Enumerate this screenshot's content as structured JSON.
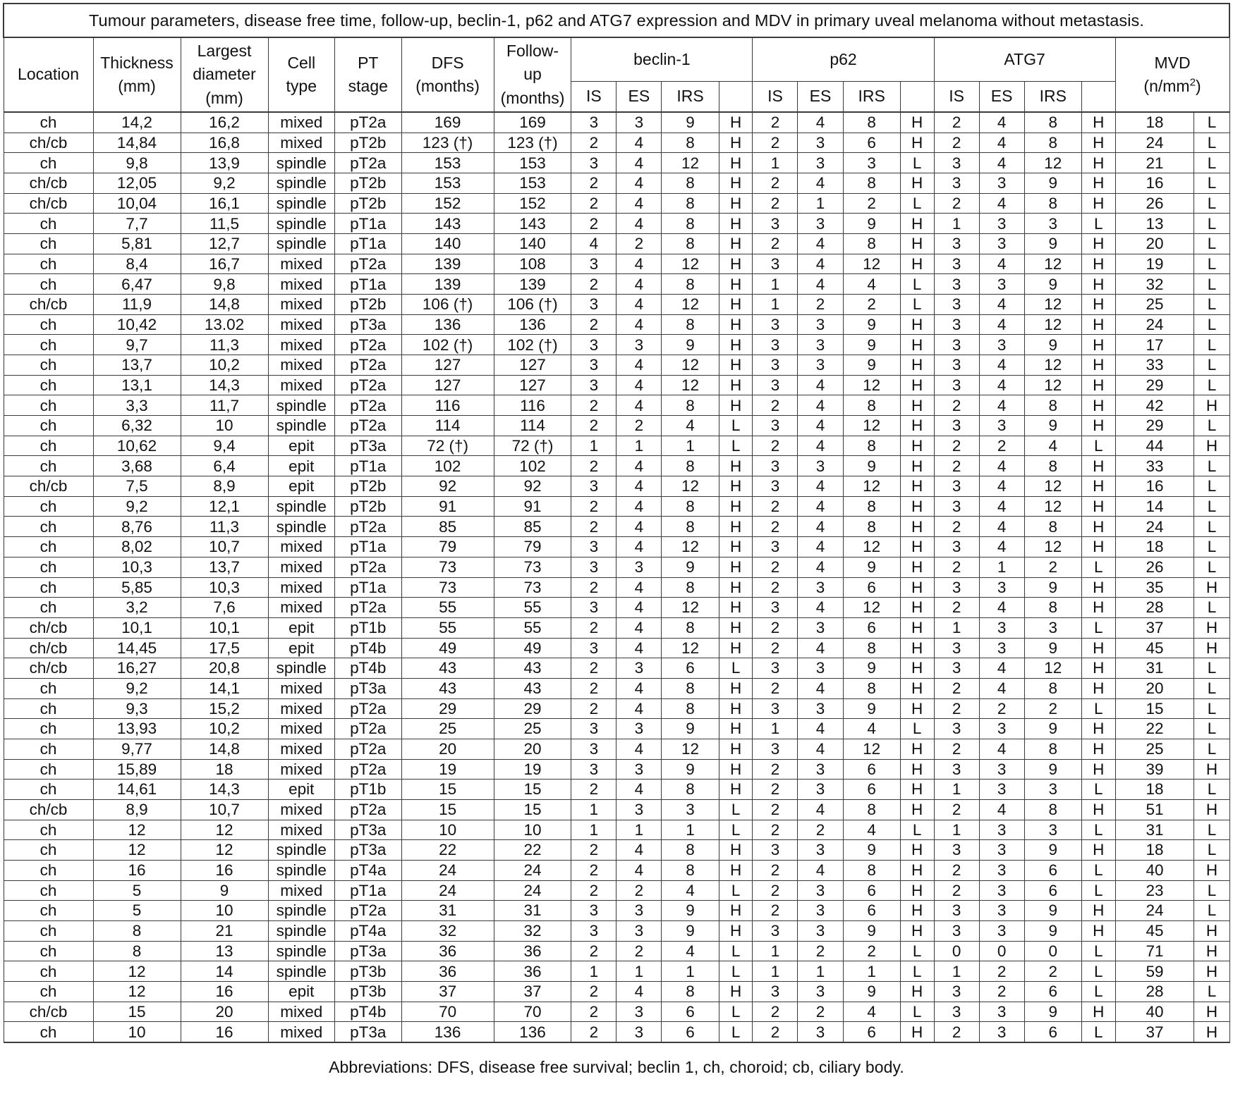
{
  "title": "Tumour parameters, disease free time, follow-up, beclin-1, p62 and ATG7 expression and MDV in primary uveal melanoma without metastasis.",
  "footer": "Abbreviations: DFS, disease free survival; beclin 1,  ch, choroid; cb, ciliary body.",
  "header": {
    "location": "Location",
    "thickness_l1": "Thickness",
    "thickness_l2": "(mm)",
    "diameter_l1": "Largest",
    "diameter_l2": "diameter",
    "diameter_l3": "(mm)",
    "celltype_l1": "Cell",
    "celltype_l2": "type",
    "ptstage_l1": "PT",
    "ptstage_l2": "stage",
    "dfs_l1": "DFS",
    "dfs_l2": "(months)",
    "followup_l1": "Follow-",
    "followup_l2": "up",
    "followup_l3": "(months)",
    "beclin1": "beclin-1",
    "p62": "p62",
    "atg7": "ATG7",
    "mvd_l1": "MVD",
    "mvd_l2_pre": "(n/mm",
    "mvd_l2_sup": "2",
    "mvd_l2_post": ")",
    "is": "IS",
    "es": "ES",
    "irs": "IRS",
    "blank": ""
  },
  "chart_data": {
    "type": "table",
    "title": "Tumour parameters, disease free time, follow-up, beclin-1, p62 and ATG7 expression and MDV in primary uveal melanoma without metastasis.",
    "columns": [
      "Location",
      "Thickness (mm)",
      "Largest diameter (mm)",
      "Cell type",
      "PT stage",
      "DFS (months)",
      "Follow-up (months)",
      "beclin-1 IS",
      "beclin-1 ES",
      "beclin-1 IRS",
      "beclin-1 HL",
      "p62 IS",
      "p62 ES",
      "p62 IRS",
      "p62 HL",
      "ATG7 IS",
      "ATG7 ES",
      "ATG7 IRS",
      "ATG7 HL",
      "MVD (n/mm2)",
      "MVD HL"
    ],
    "rows": [
      [
        "ch",
        "14,2",
        "16,2",
        "mixed",
        "pT2a",
        "169",
        "169",
        "3",
        "3",
        "9",
        "H",
        "2",
        "4",
        "8",
        "H",
        "2",
        "4",
        "8",
        "H",
        "18",
        "L"
      ],
      [
        "ch/cb",
        "14,84",
        "16,8",
        "mixed",
        "pT2b",
        "123  (†)",
        "123 (†)",
        "2",
        "4",
        "8",
        "H",
        "2",
        "3",
        "6",
        "H",
        "2",
        "4",
        "8",
        "H",
        "24",
        "L"
      ],
      [
        "ch",
        "9,8",
        "13,9",
        "spindle",
        "pT2a",
        "153",
        "153",
        "3",
        "4",
        "12",
        "H",
        "1",
        "3",
        "3",
        "L",
        "3",
        "4",
        "12",
        "H",
        "21",
        "L"
      ],
      [
        "ch/cb",
        "12,05",
        "9,2",
        "spindle",
        "pT2b",
        "153",
        "153",
        "2",
        "4",
        "8",
        "H",
        "2",
        "4",
        "8",
        "H",
        "3",
        "3",
        "9",
        "H",
        "16",
        "L"
      ],
      [
        "ch/cb",
        "10,04",
        "16,1",
        "spindle",
        "pT2b",
        "152",
        "152",
        "2",
        "4",
        "8",
        "H",
        "2",
        "1",
        "2",
        "L",
        "2",
        "4",
        "8",
        "H",
        "26",
        "L"
      ],
      [
        "ch",
        "7,7",
        "11,5",
        "spindle",
        "pT1a",
        "143",
        "143",
        "2",
        "4",
        "8",
        "H",
        "3",
        "3",
        "9",
        "H",
        "1",
        "3",
        "3",
        "L",
        "13",
        "L"
      ],
      [
        "ch",
        "5,81",
        "12,7",
        "spindle",
        "pT1a",
        "140",
        "140",
        "4",
        "2",
        "8",
        "H",
        "2",
        "4",
        "8",
        "H",
        "3",
        "3",
        "9",
        "H",
        "20",
        "L"
      ],
      [
        "ch",
        "8,4",
        "16,7",
        "mixed",
        "pT2a",
        "139",
        "108",
        "3",
        "4",
        "12",
        "H",
        "3",
        "4",
        "12",
        "H",
        "3",
        "4",
        "12",
        "H",
        "19",
        "L"
      ],
      [
        "ch",
        "6,47",
        "9,8",
        "mixed",
        "pT1a",
        "139",
        "139",
        "2",
        "4",
        "8",
        "H",
        "1",
        "4",
        "4",
        "L",
        "3",
        "3",
        "9",
        "H",
        "32",
        "L"
      ],
      [
        "ch/cb",
        "11,9",
        "14,8",
        "mixed",
        "pT2b",
        "106  (†)",
        "106 (†)",
        "3",
        "4",
        "12",
        "H",
        "1",
        "2",
        "2",
        "L",
        "3",
        "4",
        "12",
        "H",
        "25",
        "L"
      ],
      [
        "ch",
        "10,42",
        "13.02",
        "mixed",
        "pT3a",
        "136",
        "136",
        "2",
        "4",
        "8",
        "H",
        "3",
        "3",
        "9",
        "H",
        "3",
        "4",
        "12",
        "H",
        "24",
        "L"
      ],
      [
        "ch",
        "9,7",
        "11,3",
        "mixed",
        "pT2a",
        "102  (†)",
        "102 (†)",
        "3",
        "3",
        "9",
        "H",
        "3",
        "3",
        "9",
        "H",
        "3",
        "3",
        "9",
        "H",
        "17",
        "L"
      ],
      [
        "ch",
        "13,7",
        "10,2",
        "mixed",
        "pT2a",
        "127",
        "127",
        "3",
        "4",
        "12",
        "H",
        "3",
        "3",
        "9",
        "H",
        "3",
        "4",
        "12",
        "H",
        "33",
        "L"
      ],
      [
        "ch",
        "13,1",
        "14,3",
        "mixed",
        "pT2a",
        "127",
        "127",
        "3",
        "4",
        "12",
        "H",
        "3",
        "4",
        "12",
        "H",
        "3",
        "4",
        "12",
        "H",
        "29",
        "L"
      ],
      [
        "ch",
        "3,3",
        "11,7",
        "spindle",
        "pT2a",
        "116",
        "116",
        "2",
        "4",
        "8",
        "H",
        "2",
        "4",
        "8",
        "H",
        "2",
        "4",
        "8",
        "H",
        "42",
        "H"
      ],
      [
        "ch",
        "6,32",
        "10",
        "spindle",
        "pT2a",
        "114",
        "114",
        "2",
        "2",
        "4",
        "L",
        "3",
        "4",
        "12",
        "H",
        "3",
        "3",
        "9",
        "H",
        "29",
        "L"
      ],
      [
        "ch",
        "10,62",
        "9,4",
        "epit",
        "pT3a",
        "72 (†)",
        "72 (†)",
        "1",
        "1",
        "1",
        "L",
        "2",
        "4",
        "8",
        "H",
        "2",
        "2",
        "4",
        "L",
        "44",
        "H"
      ],
      [
        "ch",
        "3,68",
        "6,4",
        "epit",
        "pT1a",
        "102",
        "102",
        "2",
        "4",
        "8",
        "H",
        "3",
        "3",
        "9",
        "H",
        "2",
        "4",
        "8",
        "H",
        "33",
        "L"
      ],
      [
        "ch/cb",
        "7,5",
        "8,9",
        "epit",
        "pT2b",
        "92",
        "92",
        "3",
        "4",
        "12",
        "H",
        "3",
        "4",
        "12",
        "H",
        "3",
        "4",
        "12",
        "H",
        "16",
        "L"
      ],
      [
        "ch",
        "9,2",
        "12,1",
        "spindle",
        "pT2b",
        "91",
        "91",
        "2",
        "4",
        "8",
        "H",
        "2",
        "4",
        "8",
        "H",
        "3",
        "4",
        "12",
        "H",
        "14",
        "L"
      ],
      [
        "ch",
        "8,76",
        "11,3",
        "spindle",
        "pT2a",
        "85",
        "85",
        "2",
        "4",
        "8",
        "H",
        "2",
        "4",
        "8",
        "H",
        "2",
        "4",
        "8",
        "H",
        "24",
        "L"
      ],
      [
        "ch",
        "8,02",
        "10,7",
        "mixed",
        "pT1a",
        "79",
        "79",
        "3",
        "4",
        "12",
        "H",
        "3",
        "4",
        "12",
        "H",
        "3",
        "4",
        "12",
        "H",
        "18",
        "L"
      ],
      [
        "ch",
        "10,3",
        "13,7",
        "mixed",
        "pT2a",
        "73",
        "73",
        "3",
        "3",
        "9",
        "H",
        "2",
        "4",
        "9",
        "H",
        "2",
        "1",
        "2",
        "L",
        "26",
        "L"
      ],
      [
        "ch",
        "5,85",
        "10,3",
        "mixed",
        "pT1a",
        "73",
        "73",
        "2",
        "4",
        "8",
        "H",
        "2",
        "3",
        "6",
        "H",
        "3",
        "3",
        "9",
        "H",
        "35",
        "H"
      ],
      [
        "ch",
        "3,2",
        "7,6",
        "mixed",
        "pT2a",
        "55",
        "55",
        "3",
        "4",
        "12",
        "H",
        "3",
        "4",
        "12",
        "H",
        "2",
        "4",
        "8",
        "H",
        "28",
        "L"
      ],
      [
        "ch/cb",
        "10,1",
        "10,1",
        "epit",
        "pT1b",
        "55",
        "55",
        "2",
        "4",
        "8",
        "H",
        "2",
        "3",
        "6",
        "H",
        "1",
        "3",
        "3",
        "L",
        "37",
        "H"
      ],
      [
        "ch/cb",
        "14,45",
        "17,5",
        "epit",
        "pT4b",
        "49",
        "49",
        "3",
        "4",
        "12",
        "H",
        "2",
        "4",
        "8",
        "H",
        "3",
        "3",
        "9",
        "H",
        "45",
        "H"
      ],
      [
        "ch/cb",
        "16,27",
        "20,8",
        "spindle",
        "pT4b",
        "43",
        "43",
        "2",
        "3",
        "6",
        "L",
        "3",
        "3",
        "9",
        "H",
        "3",
        "4",
        "12",
        "H",
        "31",
        "L"
      ],
      [
        "ch",
        "9,2",
        "14,1",
        "mixed",
        "pT3a",
        "43",
        "43",
        "2",
        "4",
        "8",
        "H",
        "2",
        "4",
        "8",
        "H",
        "2",
        "4",
        "8",
        "H",
        "20",
        "L"
      ],
      [
        "ch",
        "9,3",
        "15,2",
        "mixed",
        "pT2a",
        "29",
        "29",
        "2",
        "4",
        "8",
        "H",
        "3",
        "3",
        "9",
        "H",
        "2",
        "2",
        "2",
        "L",
        "15",
        "L"
      ],
      [
        "ch",
        "13,93",
        "10,2",
        "mixed",
        "pT2a",
        "25",
        "25",
        "3",
        "3",
        "9",
        "H",
        "1",
        "4",
        "4",
        "L",
        "3",
        "3",
        "9",
        "H",
        "22",
        "L"
      ],
      [
        "ch",
        "9,77",
        "14,8",
        "mixed",
        "pT2a",
        "20",
        "20",
        "3",
        "4",
        "12",
        "H",
        "3",
        "4",
        "12",
        "H",
        "2",
        "4",
        "8",
        "H",
        "25",
        "L"
      ],
      [
        "ch",
        "15,89",
        "18",
        "mixed",
        "pT2a",
        "19",
        "19",
        "3",
        "3",
        "9",
        "H",
        "2",
        "3",
        "6",
        "H",
        "3",
        "3",
        "9",
        "H",
        "39",
        "H"
      ],
      [
        "ch",
        "14,61",
        "14,3",
        "epit",
        "pT1b",
        "15",
        "15",
        "2",
        "4",
        "8",
        "H",
        "2",
        "3",
        "6",
        "H",
        "1",
        "3",
        "3",
        "L",
        "18",
        "L"
      ],
      [
        "ch/cb",
        "8,9",
        "10,7",
        "mixed",
        "pT2a",
        "15",
        "15",
        "1",
        "3",
        "3",
        "L",
        "2",
        "4",
        "8",
        "H",
        "2",
        "4",
        "8",
        "H",
        "51",
        "H"
      ],
      [
        "ch",
        "12",
        "12",
        "mixed",
        "pT3a",
        "10",
        "10",
        "1",
        "1",
        "1",
        "L",
        "2",
        "2",
        "4",
        "L",
        "1",
        "3",
        "3",
        "L",
        "31",
        "L"
      ],
      [
        "ch",
        "12",
        "12",
        "spindle",
        "pT3a",
        "22",
        "22",
        "2",
        "4",
        "8",
        "H",
        "3",
        "3",
        "9",
        "H",
        "3",
        "3",
        "9",
        "H",
        "18",
        "L"
      ],
      [
        "ch",
        "16",
        "16",
        "spindle",
        "pT4a",
        "24",
        "24",
        "2",
        "4",
        "8",
        "H",
        "2",
        "4",
        "8",
        "H",
        "2",
        "3",
        "6",
        "L",
        "40",
        "H"
      ],
      [
        "ch",
        "5",
        "9",
        "mixed",
        "pT1a",
        "24",
        "24",
        "2",
        "2",
        "4",
        "L",
        "2",
        "3",
        "6",
        "H",
        "2",
        "3",
        "6",
        "L",
        "23",
        "L"
      ],
      [
        "ch",
        "5",
        "10",
        "spindle",
        "pT2a",
        "31",
        "31",
        "3",
        "3",
        "9",
        "H",
        "2",
        "3",
        "6",
        "H",
        "3",
        "3",
        "9",
        "H",
        "24",
        "L"
      ],
      [
        "ch",
        "8",
        "21",
        "spindle",
        "pT4a",
        "32",
        "32",
        "3",
        "3",
        "9",
        "H",
        "3",
        "3",
        "9",
        "H",
        "3",
        "3",
        "9",
        "H",
        "45",
        "H"
      ],
      [
        "ch",
        "8",
        "13",
        "spindle",
        "pT3a",
        "36",
        "36",
        "2",
        "2",
        "4",
        "L",
        "1",
        "2",
        "2",
        "L",
        "0",
        "0",
        "0",
        "L",
        "71",
        "H"
      ],
      [
        "ch",
        "12",
        "14",
        "spindle",
        "pT3b",
        "36",
        "36",
        "1",
        "1",
        "1",
        "L",
        "1",
        "1",
        "1",
        "L",
        "1",
        "2",
        "2",
        "L",
        "59",
        "H"
      ],
      [
        "ch",
        "12",
        "16",
        "epit",
        "pT3b",
        "37",
        "37",
        "2",
        "4",
        "8",
        "H",
        "3",
        "3",
        "9",
        "H",
        "3",
        "2",
        "6",
        "L",
        "28",
        "L"
      ],
      [
        "ch/cb",
        "15",
        "20",
        "mixed",
        "pT4b",
        "70",
        "70",
        "2",
        "3",
        "6",
        "L",
        "2",
        "2",
        "4",
        "L",
        "3",
        "3",
        "9",
        "H",
        "40",
        "H"
      ],
      [
        "ch",
        "10",
        "16",
        "mixed",
        "pT3a",
        "136",
        "136",
        "2",
        "3",
        "6",
        "L",
        "2",
        "3",
        "6",
        "H",
        "2",
        "3",
        "6",
        "L",
        "37",
        "H"
      ]
    ]
  }
}
